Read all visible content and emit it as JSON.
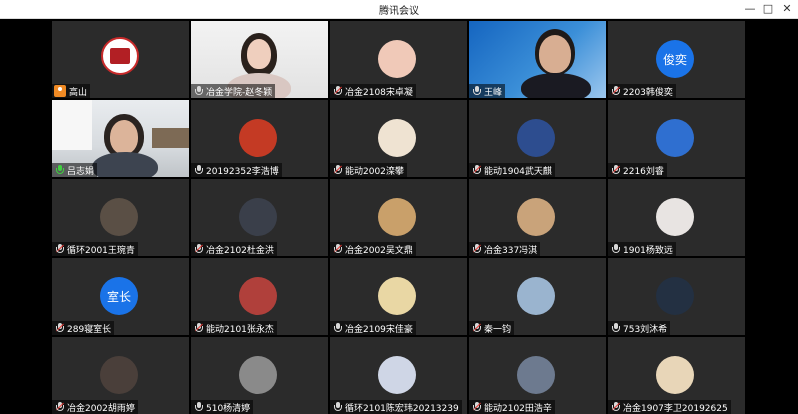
{
  "window": {
    "title": "腾讯会议",
    "controls": [
      "—",
      "□",
      "✕"
    ]
  },
  "colors": {
    "tile_bg": "#2b2b2b",
    "active_speaker": "#3fbf3f",
    "text_avatar_blue": "#1a73e8",
    "host_badge": "#f08a24"
  },
  "participants": [
    {
      "name": "高山",
      "kind": "logo",
      "badge": "host"
    },
    {
      "name": "冶金学院-赵冬颖",
      "kind": "camera-woman",
      "mic": "on"
    },
    {
      "name": "冶金2108宋卓凝",
      "kind": "avatar",
      "avatar_color": "#f0c9b8",
      "mic": "muted"
    },
    {
      "name": "王峰",
      "kind": "camera-man-blue",
      "mic": "on"
    },
    {
      "name": "2203韩俊奕",
      "kind": "text-avatar",
      "avatar_text": "俊奕",
      "mic": "muted"
    },
    {
      "name": "吕志娟",
      "kind": "camera-room",
      "mic": "speaking",
      "active": true
    },
    {
      "name": "20192352李浩博",
      "kind": "avatar",
      "avatar_color": "#c43a24"
    },
    {
      "name": "能动2002滦攀",
      "kind": "avatar",
      "avatar_color": "#efe3d2",
      "mic": "muted"
    },
    {
      "name": "能动1904武天麒",
      "kind": "avatar",
      "avatar_color": "#2d4d8f",
      "mic": "muted"
    },
    {
      "name": "2216刘睿",
      "kind": "avatar",
      "avatar_color": "#2f6fd0",
      "mic": "muted"
    },
    {
      "name": "循环2001王琬青",
      "kind": "avatar",
      "avatar_color": "#5a4f45",
      "mic": "muted"
    },
    {
      "name": "冶金2102杜金洪",
      "kind": "avatar",
      "avatar_color": "#3a3f4a",
      "mic": "muted"
    },
    {
      "name": "冶金2002吴文鼎",
      "kind": "avatar",
      "avatar_color": "#c9a06a",
      "mic": "muted"
    },
    {
      "name": "冶金337冯淇",
      "kind": "avatar",
      "avatar_color": "#c9a37a",
      "mic": "muted"
    },
    {
      "name": "1901杨致远",
      "kind": "avatar",
      "avatar_color": "#e8e4e2"
    },
    {
      "name": "289寝室长",
      "kind": "text-avatar",
      "avatar_text": "室长",
      "mic": "muted"
    },
    {
      "name": "能动2101张永杰",
      "kind": "avatar",
      "avatar_color": "#b0403b",
      "mic": "muted"
    },
    {
      "name": "冶金2109宋佳豪",
      "kind": "avatar",
      "avatar_color": "#e9d7a4"
    },
    {
      "name": "秦一钧",
      "kind": "avatar",
      "avatar_color": "#9ab4cf",
      "mic": "muted"
    },
    {
      "name": "753刘沐希",
      "kind": "avatar",
      "avatar_color": "#233042"
    },
    {
      "name": "冶金2002胡雨婷",
      "kind": "avatar",
      "avatar_color": "#4a3f3a",
      "mic": "muted"
    },
    {
      "name": "510杨清婷",
      "kind": "avatar",
      "avatar_color": "#8a8a8a"
    },
    {
      "name": "循环2101陈宏玮20213239",
      "kind": "avatar",
      "avatar_color": "#cfd6e6"
    },
    {
      "name": "能动2102田浩辛",
      "kind": "avatar",
      "avatar_color": "#6d7a8f",
      "mic": "muted"
    },
    {
      "name": "冶金1907李卫20192625",
      "kind": "avatar",
      "avatar_color": "#e8d6b8",
      "mic": "muted"
    }
  ]
}
